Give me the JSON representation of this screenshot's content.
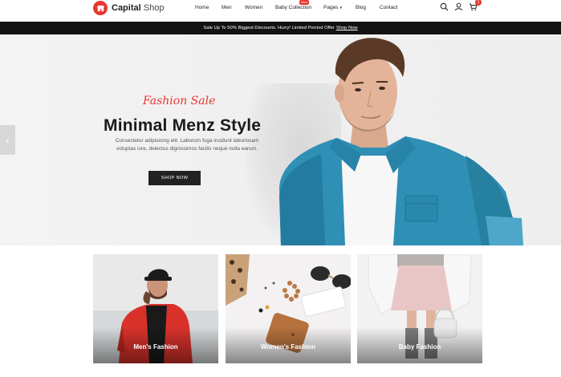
{
  "header": {
    "brand_bold": "Capital",
    "brand_light": "Shop",
    "nav": [
      {
        "label": "Home"
      },
      {
        "label": "Men"
      },
      {
        "label": "Women"
      },
      {
        "label": "Baby Collection",
        "badge": "New"
      },
      {
        "label": "Pages"
      },
      {
        "label": "Blog"
      },
      {
        "label": "Contact"
      }
    ],
    "icons": [
      "search-icon",
      "user-icon",
      "cart-icon"
    ],
    "cart_count": "1"
  },
  "promo": {
    "text": "Sale Up To 50% Biggest Discounts. Hurry! Limited Perriod Offer",
    "link": "Shop Now"
  },
  "hero": {
    "eyebrow": "Fashion Sale",
    "title": "Minimal Menz Style",
    "description": "Consectetur adipisicing elit. Laborum fuga incidunt laboriosam voluptas iure, delectus dignissimos facilis neque nulla earum.",
    "button": "SHOP NOW",
    "prev_arrow": "‹"
  },
  "categories": [
    {
      "label": "Men's Fashion"
    },
    {
      "label": "Women's Fashion"
    },
    {
      "label": "Baby Fashion"
    }
  ],
  "colors": {
    "accent": "#e8362f",
    "dark": "#121212",
    "denim": "#2f8fb5"
  }
}
